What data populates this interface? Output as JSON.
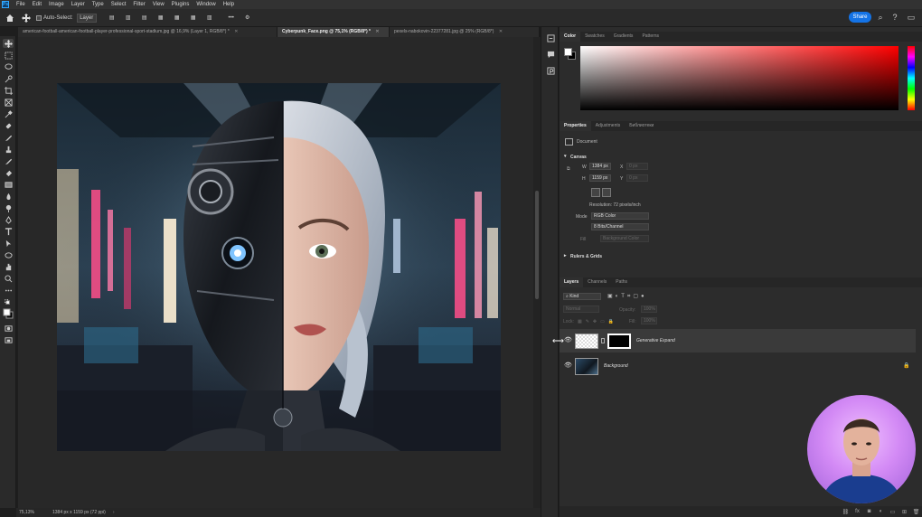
{
  "menubar": {
    "items": [
      "File",
      "Edit",
      "Image",
      "Layer",
      "Type",
      "Select",
      "Filter",
      "View",
      "Plugins",
      "Window",
      "Help"
    ]
  },
  "options": {
    "auto_select_label": "Auto-Select:",
    "auto_select_value": "Layer",
    "share_label": "Share"
  },
  "tabs": [
    {
      "label": "american-football-american-football-player-professional-sport-stadium.jpg @ 16,9% (Layer 1, RGB/8*) *"
    },
    {
      "label": "Cyberpunk_Face.png @ 75,1% (RGB/8*) *"
    },
    {
      "label": "pexels-nabokovin-22377281.jpg @ 25% (RGB/8*)"
    }
  ],
  "status": {
    "zoom": "75,13%",
    "doc_info": "1384 px x 1159 px (72 ppi)"
  },
  "color_panel": {
    "tabs": [
      "Color",
      "Swatches",
      "Gradients",
      "Patterns"
    ],
    "foreground": "#ffffff",
    "background": "#000000"
  },
  "properties": {
    "tabs": [
      "Properties",
      "Adjustments",
      "Библиотеки"
    ],
    "document_label": "Document",
    "canvas_label": "Canvas",
    "w_label": "W",
    "w_value": "1384 px",
    "h_label": "H",
    "h_value": "1159 px",
    "x_label": "X",
    "x_value": "0 px",
    "y_label": "Y",
    "y_value": "0 px",
    "resolution": "Resolution: 72 pixels/inch",
    "mode_label": "Mode",
    "mode_value": "RGB Color",
    "depth_value": "8 Bits/Channel",
    "fill_label": "Fill",
    "fill_value": "Background Color",
    "rulers_label": "Rulers & Grids"
  },
  "layers": {
    "tabs": [
      "Layers",
      "Channels",
      "Paths"
    ],
    "kind_label": "Kind",
    "blend_mode": "Normal",
    "opacity_label": "Opacity:",
    "opacity_value": "100%",
    "lock_label": "Lock:",
    "fill_label": "Fill:",
    "fill_value": "100%",
    "rows": [
      {
        "name": "Generative Expand"
      },
      {
        "name": "Background"
      }
    ]
  }
}
